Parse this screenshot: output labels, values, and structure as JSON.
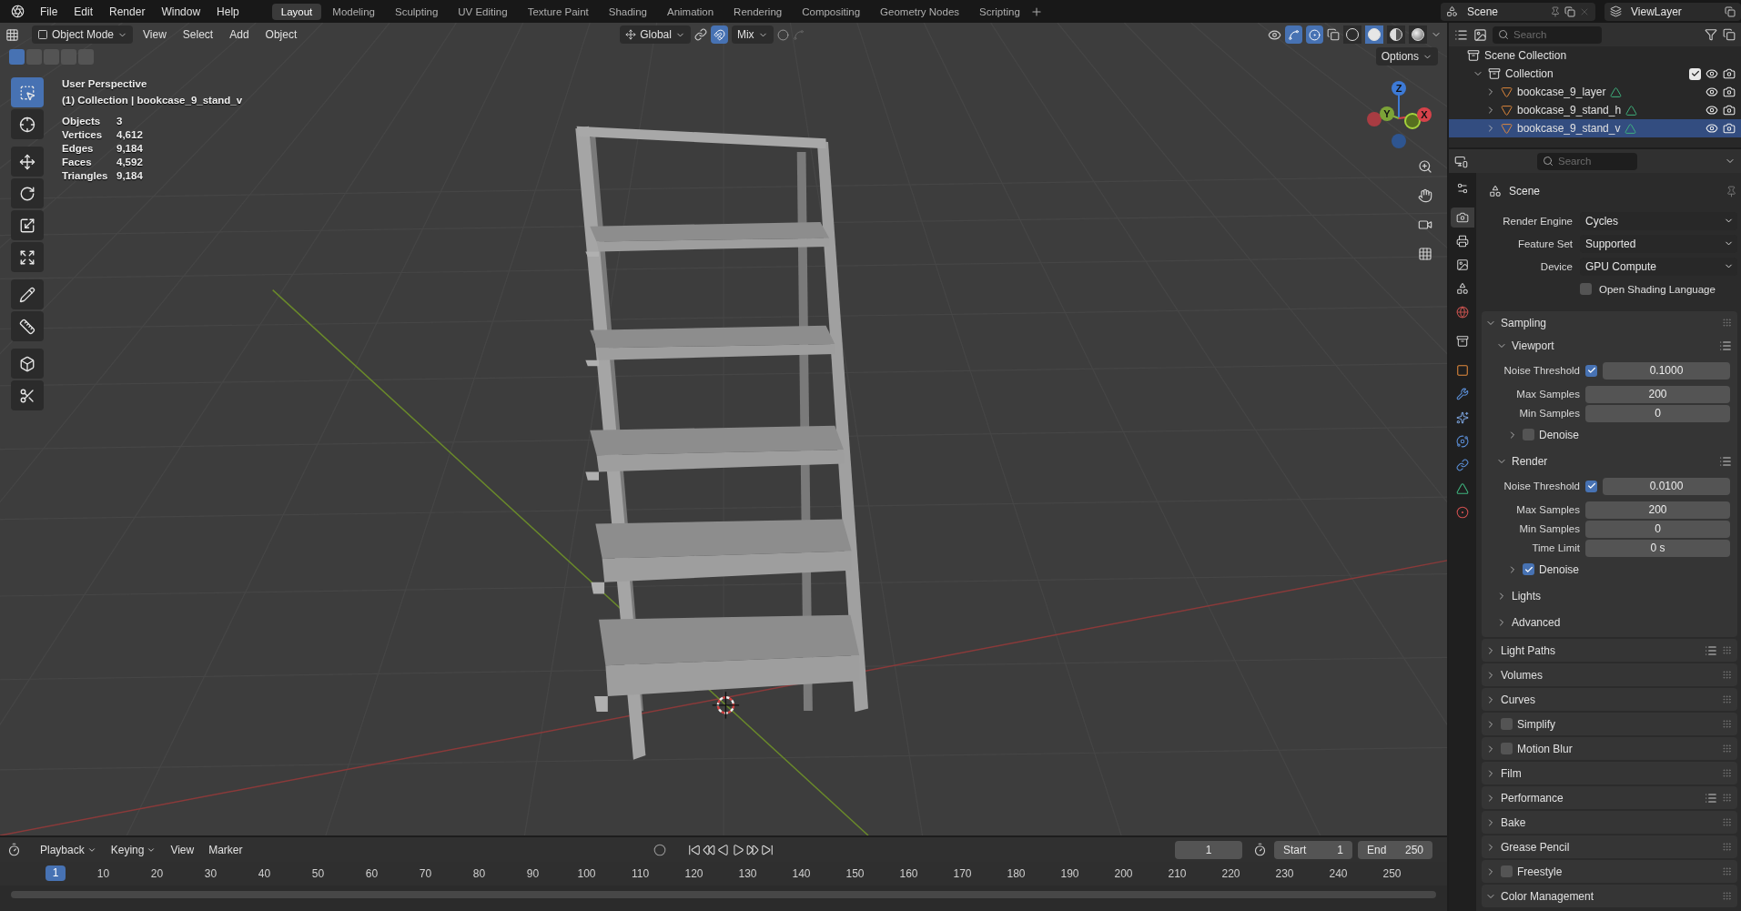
{
  "menu": [
    "File",
    "Edit",
    "Render",
    "Window",
    "Help"
  ],
  "workspaces": [
    {
      "label": "Layout",
      "selected": true
    },
    {
      "label": "Modeling",
      "selected": false
    },
    {
      "label": "Sculpting",
      "selected": false
    },
    {
      "label": "UV Editing",
      "selected": false
    },
    {
      "label": "Texture Paint",
      "selected": false
    },
    {
      "label": "Shading",
      "selected": false
    },
    {
      "label": "Animation",
      "selected": false
    },
    {
      "label": "Rendering",
      "selected": false
    },
    {
      "label": "Compositing",
      "selected": false
    },
    {
      "label": "Geometry Nodes",
      "selected": false
    },
    {
      "label": "Scripting",
      "selected": false
    }
  ],
  "scene": "Scene",
  "view_layer": "ViewLayer",
  "viewport": {
    "mode": "Object Mode",
    "menus": [
      "View",
      "Select",
      "Add",
      "Object"
    ],
    "orientation": "Global",
    "snap_mode": "Mix",
    "options": "Options",
    "tools": [
      {
        "kind": "select",
        "selected": true
      },
      {
        "kind": "cursor",
        "selected": false
      },
      {
        "kind": "move",
        "selected": false
      },
      {
        "kind": "rotate",
        "selected": false
      },
      {
        "kind": "scale",
        "selected": false
      },
      {
        "kind": "transform",
        "selected": false
      },
      {
        "kind": "annotate",
        "selected": false
      },
      {
        "kind": "measure",
        "selected": false
      },
      {
        "kind": "add",
        "selected": false
      },
      {
        "kind": "cut",
        "selected": false
      }
    ],
    "select_modes": [
      {
        "selected": true
      },
      {
        "selected": false
      },
      {
        "selected": false
      },
      {
        "selected": false
      },
      {
        "selected": false
      }
    ],
    "shading": [
      {
        "selected": false
      },
      {
        "selected": true
      },
      {
        "selected": false
      },
      {
        "selected": false
      }
    ],
    "overlay_title": "User Perspective",
    "overlay_subtitle": "(1) Collection | bookcase_9_stand_v",
    "stats": [
      {
        "label": "Objects",
        "value": "3"
      },
      {
        "label": "Vertices",
        "value": "4,612"
      },
      {
        "label": "Edges",
        "value": "9,184"
      },
      {
        "label": "Faces",
        "value": "4,592"
      },
      {
        "label": "Triangles",
        "value": "9,184"
      }
    ],
    "gizmo": {
      "z": "Z",
      "y": "Y",
      "x": "X"
    }
  },
  "outliner": {
    "search_placeholder": "Search",
    "root": "Scene Collection",
    "collection": {
      "label": "Collection",
      "expanded": true,
      "checked": true,
      "children": [
        {
          "label": "bookcase_9_layer",
          "selected": false,
          "expanded": false
        },
        {
          "label": "bookcase_9_stand_h",
          "selected": false,
          "expanded": false
        },
        {
          "label": "bookcase_9_stand_v",
          "selected": true,
          "expanded": false
        }
      ]
    }
  },
  "properties": {
    "search_placeholder": "Search",
    "title": "Scene",
    "tabs": [
      {
        "kind": "tool",
        "selected": false
      },
      {
        "kind": "render",
        "selected": true
      },
      {
        "kind": "output",
        "selected": false
      },
      {
        "kind": "view_layer",
        "selected": false
      },
      {
        "kind": "scene",
        "selected": false
      },
      {
        "kind": "world",
        "selected": false
      },
      {
        "kind": "collection",
        "selected": false
      },
      {
        "kind": "object",
        "selected": false
      },
      {
        "kind": "modifiers",
        "selected": false
      },
      {
        "kind": "particles",
        "selected": false
      },
      {
        "kind": "physics",
        "selected": false
      },
      {
        "kind": "constraints",
        "selected": false
      },
      {
        "kind": "data",
        "selected": false
      },
      {
        "kind": "material",
        "selected": false
      }
    ],
    "fields": [
      {
        "label": "Render Engine",
        "value": "Cycles"
      },
      {
        "label": "Feature Set",
        "value": "Supported"
      },
      {
        "label": "Device",
        "value": "GPU Compute"
      }
    ],
    "osl": {
      "label": "Open Shading Language",
      "checked": false
    },
    "panels": [
      {
        "label": "Sampling",
        "expanded": true,
        "children": [
          {
            "label": "Viewport",
            "expanded": true,
            "presets": true,
            "rows": [
              {
                "label": "Noise Threshold",
                "value": "0.1000",
                "checked": true
              },
              {
                "label": "Max Samples",
                "value": "200"
              },
              {
                "label": "Min Samples",
                "value": "0"
              }
            ],
            "children": [
              {
                "label": "Denoise",
                "expanded": false,
                "checked": false
              }
            ]
          },
          {
            "label": "Render",
            "expanded": true,
            "presets": true,
            "rows": [
              {
                "label": "Noise Threshold",
                "value": "0.0100",
                "checked": true
              },
              {
                "label": "Max Samples",
                "value": "200"
              },
              {
                "label": "Min Samples",
                "value": "0"
              },
              {
                "label": "Time Limit",
                "value": "0 s"
              }
            ],
            "children": [
              {
                "label": "Denoise",
                "expanded": false,
                "checked": true
              }
            ]
          },
          {
            "label": "Lights",
            "expanded": false
          },
          {
            "label": "Advanced",
            "expanded": false
          }
        ]
      },
      {
        "label": "Light Paths",
        "expanded": false,
        "presets": true
      },
      {
        "label": "Volumes",
        "expanded": false
      },
      {
        "label": "Curves",
        "expanded": false
      },
      {
        "label": "Simplify",
        "expanded": false,
        "checked": false
      },
      {
        "label": "Motion Blur",
        "expanded": false,
        "checked": false
      },
      {
        "label": "Film",
        "expanded": false
      },
      {
        "label": "Performance",
        "expanded": false,
        "presets": true
      },
      {
        "label": "Bake",
        "expanded": false
      },
      {
        "label": "Grease Pencil",
        "expanded": false
      },
      {
        "label": "Freestyle",
        "expanded": false,
        "checked": false
      },
      {
        "label": "Color Management",
        "expanded": true
      }
    ]
  },
  "timeline": {
    "menus": [
      {
        "label": "Playback",
        "dropdown": true
      },
      {
        "label": "Keying",
        "dropdown": true
      },
      {
        "label": "View",
        "dropdown": false
      },
      {
        "label": "Marker",
        "dropdown": false
      }
    ],
    "current_frame": "1",
    "start_label": "Start",
    "start": "1",
    "end_label": "End",
    "end": "250",
    "playhead": "1",
    "ticks": [
      "10",
      "20",
      "30",
      "40",
      "50",
      "60",
      "70",
      "80",
      "90",
      "100",
      "110",
      "120",
      "130",
      "140",
      "150",
      "160",
      "170",
      "180",
      "190",
      "200",
      "210",
      "220",
      "230",
      "240",
      "250"
    ]
  }
}
